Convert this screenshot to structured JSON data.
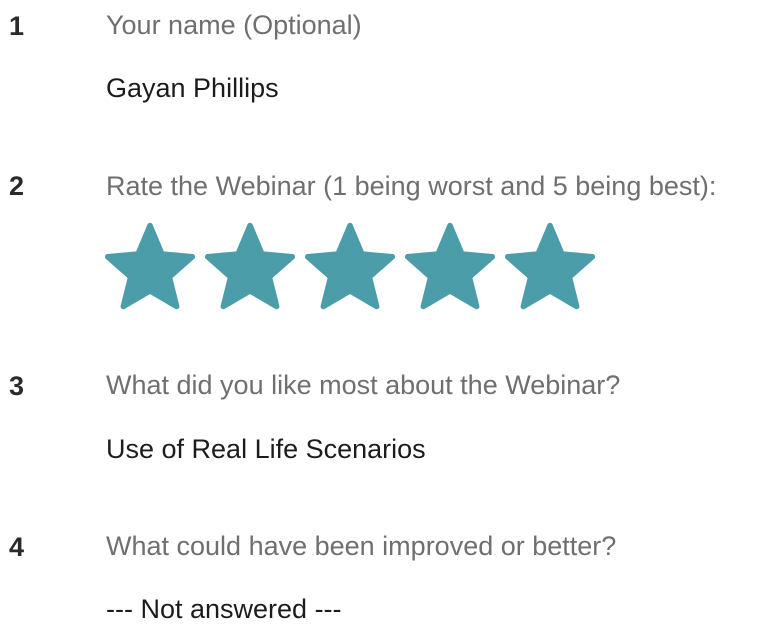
{
  "questions": [
    {
      "number": "1",
      "text": "Your name (Optional)",
      "answer": "Gayan Phillips"
    },
    {
      "number": "2",
      "text": "Rate the Webinar (1 being worst and 5 being best):",
      "rating": 5,
      "rating_max": 5,
      "rating_icon": "star-icon",
      "star_color": "#4a9da9"
    },
    {
      "number": "3",
      "text": "What did you like most about the Webinar?",
      "answer": "Use of Real Life Scenarios"
    },
    {
      "number": "4",
      "text": "What could have been improved or better?",
      "answer": "--- Not answered ---"
    }
  ]
}
